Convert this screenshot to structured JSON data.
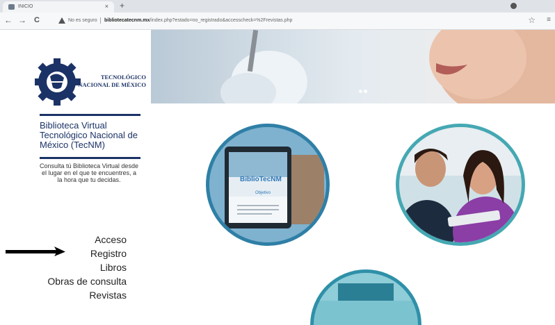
{
  "browser": {
    "tab_title": "INICIO",
    "tab_close": "×",
    "new_tab": "+",
    "back": "←",
    "forward": "→",
    "reload": "C",
    "security_label": "No es seguro",
    "url_domain": "bibliotecatecnm.mx",
    "url_path": "/index.php?estado=no_registrado&accesscheck=%2Frevistas.php",
    "star": "☆",
    "menu": "≡"
  },
  "sidebar": {
    "brand_line1": "TECNOLÓGICO",
    "brand_line2": "NACIONAL DE MÉXICO",
    "title": "Biblioteca Virtual Tecnológico Nacional de México (TecNM)",
    "tagline": "Consulta tú Biblioteca Virtual desde el lugar en el que te encuentres, a la hora que tu decidas.",
    "nav": [
      "Acceso",
      "Registro",
      "Libros",
      "Obras de consulta",
      "Revistas"
    ]
  },
  "main": {
    "circle1_logo": "BiblioTecNM",
    "circle1_screen_title": "Objetivo"
  }
}
